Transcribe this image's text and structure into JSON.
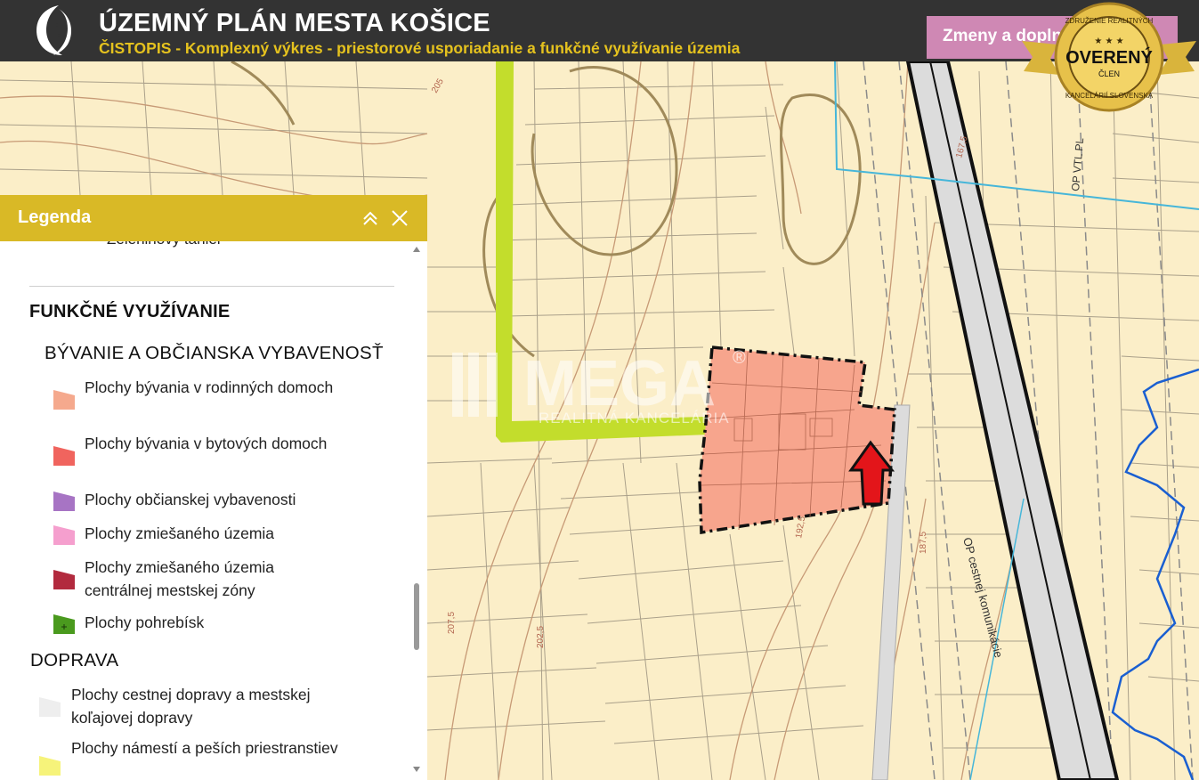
{
  "header": {
    "title": "ÚZEMNÝ PLÁN MESTA KOŠICE",
    "subtitle": "ČISTOPIS - Komplexný výkres - priestorové usporiadanie a funkčné využívanie územia",
    "changes_button": "Zmeny a doplnky",
    "colors": {
      "bar": "#333333",
      "subtitle": "#e5c21e",
      "button": "#cf88b4"
    }
  },
  "badge": {
    "top_text": "ZDRUŽENIE REALITNÝCH",
    "main_text": "OVERENÝ",
    "sub_text": "ČLEN",
    "bottom_text": "KANCELÁRIÍ SLOVENSKA",
    "stars": "★ ★ ★"
  },
  "watermark": {
    "brand": "MEGA",
    "reg": "®",
    "tagline": "REALITNÁ KANCELÁRIA"
  },
  "map": {
    "contour_labels": [
      "207,5",
      "202,5",
      "192,5",
      "187,5",
      "167,5",
      "187,5",
      "205",
      "OP cestnej komunikácie",
      "OP VTL PL"
    ],
    "colors": {
      "background": "#fbeec8",
      "highlight_area": "#f7a58d",
      "greenway": "#c3dd2c",
      "roads": "#d9d9d9",
      "water": "#1a5fd1",
      "arrow": "#e3151a"
    }
  },
  "legend": {
    "title": "Legenda",
    "cut_item": "Zeleninový tanier",
    "section": "FUNKČNÉ VYUŽÍVANIE",
    "groups": [
      {
        "name": "BÝVANIE A OBČIANSKA VYBAVENOSŤ",
        "items": [
          {
            "label": "Plochy bývania v rodinných domoch",
            "color": "#f5a98d"
          },
          {
            "label": "Plochy bývania v bytových domoch",
            "color": "#f0645e"
          },
          {
            "label": "Plochy občianskej vybavenosti",
            "color": "#a774c4"
          },
          {
            "label": "Plochy zmiešaného územia",
            "color": "#f59fce"
          },
          {
            "label": "Plochy zmiešaného územia centrálnej mestskej zóny",
            "color": "#b22a3e"
          },
          {
            "label": "Plochy pohrebísk",
            "color": "#4a9a1e"
          }
        ]
      },
      {
        "name": "DOPRAVA",
        "items": [
          {
            "label": "Plochy cestnej dopravy a mestskej koľajovej dopravy",
            "color": "#eeeeee"
          },
          {
            "label": "Plochy námestí a peších priestranstiev",
            "color": "#f6f37a"
          }
        ]
      }
    ]
  }
}
